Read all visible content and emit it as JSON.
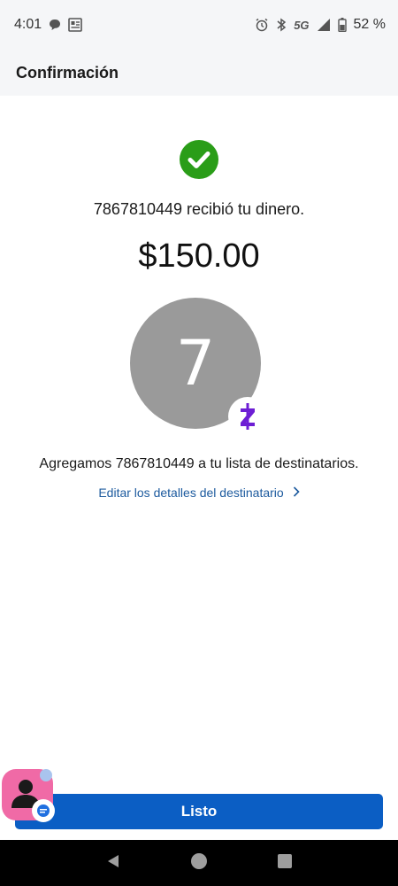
{
  "status_bar": {
    "time": "4:01",
    "network": "5G",
    "battery": "52 %",
    "icons": [
      "chat-bubble-icon",
      "news-icon",
      "alarm-icon",
      "bluetooth-icon",
      "signal-icon",
      "battery-icon"
    ]
  },
  "header": {
    "title": "Confirmación"
  },
  "confirmation": {
    "received_text": "7867810449 recibió tu dinero.",
    "amount": "$150.00",
    "avatar_letter": "7",
    "added_text": "Agregamos 7867810449 a tu lista de destinatarios.",
    "edit_link": "Editar los detalles del destinatario"
  },
  "actions": {
    "done_label": "Listo"
  },
  "colors": {
    "success_green": "#2a9d18",
    "zelle_purple": "#6d1ed4",
    "link_blue": "#1c5a9e",
    "button_blue": "#0b5ec4",
    "avatar_gray": "#9a9a9a"
  },
  "nav_icons": [
    "back-icon",
    "home-icon",
    "recents-icon"
  ]
}
